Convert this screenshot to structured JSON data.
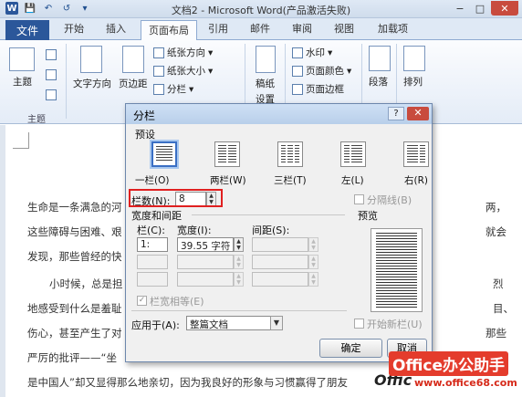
{
  "window": {
    "title": "文档2 - Microsoft Word(产品激活失败)",
    "buttons": {
      "minimize": "−",
      "maximize": "□",
      "close": "✕"
    },
    "qat": {
      "save": "💾",
      "undo": "↶",
      "redo": "↺",
      "more": "▾"
    }
  },
  "ribbon": {
    "file_tab": "文件",
    "tabs": [
      "开始",
      "插入",
      "页面布局",
      "引用",
      "邮件",
      "审阅",
      "视图",
      "加载项"
    ],
    "active_tab": "页面布局",
    "groups": {
      "theme": {
        "label": "主题",
        "button": "主题"
      },
      "page_setup": {
        "text_direction": "文字方向",
        "margins": "页边距",
        "orientation": "纸张方向",
        "size": "纸张大小",
        "columns": "分栏",
        "dropdown": "▾"
      },
      "draft": {
        "button": "稿纸\n设置",
        "line1": "稿纸",
        "line2": "设置"
      },
      "background": {
        "watermark": "水印",
        "page_color": "页面颜色",
        "page_border": "页面边框"
      },
      "paragraph": {
        "button": "段落"
      },
      "arrange": {
        "button": "排列"
      }
    }
  },
  "document": {
    "lines": [
      "生命是一条满急的河",
      "这些障碍与困难、艰",
      "发现，那些曾经的快",
      "小时候，总是担",
      "地感受到什么是羞耻",
      "伤心，甚至产生了对",
      "严厉的批评——“坐",
      "是中国人”却又显得那么地亲切，因为我良好的形象与习惯赢得了朋友"
    ],
    "right_fragments": [
      "两，",
      "就会",
      "烈",
      "目、",
      "那些"
    ]
  },
  "dialog": {
    "title": "分栏",
    "help": "?",
    "close": "✕",
    "presets_label": "预设",
    "presets": [
      {
        "label": "一栏(O)",
        "cols": 1
      },
      {
        "label": "两栏(W)",
        "cols": 2
      },
      {
        "label": "三栏(T)",
        "cols": 3
      },
      {
        "label": "左(L)",
        "cols": 2
      },
      {
        "label": "右(R)",
        "cols": 2
      }
    ],
    "num_cols_label": "栏数(N):",
    "num_cols_value": "8",
    "separator_label": "分隔线(B)",
    "width_spacing_label": "宽度和间距",
    "headers": {
      "col": "栏(C):",
      "width": "宽度(I):",
      "spacing": "间距(S):"
    },
    "rows": [
      {
        "col": "1:",
        "width": "39.55 字符",
        "spacing": ""
      },
      {
        "col": "",
        "width": "",
        "spacing": ""
      },
      {
        "col": "",
        "width": "",
        "spacing": ""
      }
    ],
    "equal_width_label": "栏宽相等(E)",
    "preview_label": "预览",
    "apply_to_label": "应用于(A):",
    "apply_to_value": "整篇文档",
    "new_column_label": "开始新栏(U)",
    "ok": "确定",
    "cancel": "取消"
  },
  "watermark": {
    "main": "Office办公助手",
    "sub": "www.office68.com",
    "badge": "Offic"
  },
  "colors": {
    "file_tab": "#2b579a",
    "close": "#c84b3e",
    "highlight": "#e02020",
    "accent": "#3a6fc4"
  }
}
